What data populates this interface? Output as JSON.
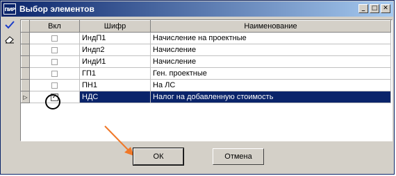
{
  "window": {
    "title": "Выбор элементов",
    "app_icon_text": "ПИР",
    "controls": [
      "_",
      "□",
      "✕"
    ]
  },
  "toolbar": {
    "check_icon": "check-icon",
    "eraser_icon": "eraser-icon"
  },
  "table": {
    "columns": [
      "Вкл",
      "Шифр",
      "Наименование"
    ],
    "rows": [
      {
        "checked": false,
        "code": "ИндП1",
        "name": "Начисление на проектные"
      },
      {
        "checked": false,
        "code": "Индп2",
        "name": "Начисление"
      },
      {
        "checked": false,
        "code": "ИндИ1",
        "name": "Начисление"
      },
      {
        "checked": false,
        "code": "ГП1",
        "name": "Ген. проектные"
      },
      {
        "checked": false,
        "code": "ПН1",
        "name": "На ЛС"
      },
      {
        "checked": true,
        "code": "НДС",
        "name": "Налог на добавленную стоимость"
      }
    ],
    "selected_row_index": 5,
    "current_row_marker": "▷"
  },
  "buttons": {
    "ok": "ОК",
    "cancel": "Отмена"
  },
  "colors": {
    "title_gradient_start": "#0a246a",
    "title_gradient_end": "#a6caf0",
    "selection": "#0a246a",
    "annotation_arrow": "#f07828"
  }
}
